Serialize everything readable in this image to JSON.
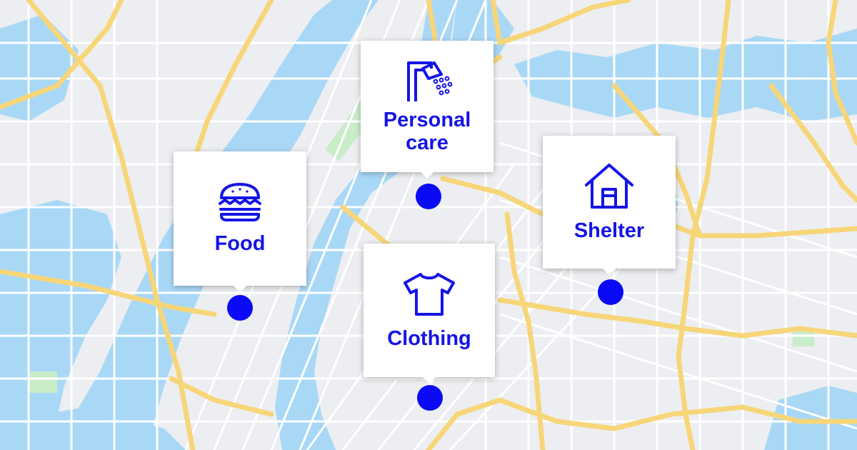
{
  "map": {
    "colors": {
      "land": "#eceef1",
      "water": "#a9d8f7",
      "park": "#c9ecc9",
      "street": "#ffffff",
      "highway": "#f7d679",
      "accent": "#1414e6",
      "pin": "#0a0af5"
    }
  },
  "markers": [
    {
      "label": "Food",
      "icon": "burger-icon"
    },
    {
      "label": "Personal\ncare",
      "icon": "shower-icon"
    },
    {
      "label": "Shelter",
      "icon": "house-icon"
    },
    {
      "label": "Clothing",
      "icon": "tshirt-icon"
    }
  ]
}
